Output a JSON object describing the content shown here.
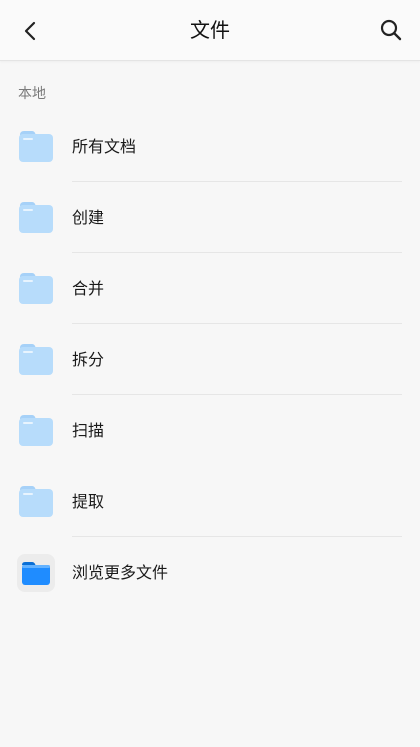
{
  "header": {
    "title": "文件",
    "back_icon": "chevron-left-icon",
    "search_icon": "search-icon"
  },
  "section": {
    "label": "本地"
  },
  "items": [
    {
      "label": "所有文档",
      "icon": "folder-icon"
    },
    {
      "label": "创建",
      "icon": "folder-icon"
    },
    {
      "label": "合并",
      "icon": "folder-icon"
    },
    {
      "label": "拆分",
      "icon": "folder-icon"
    },
    {
      "label": "扫描",
      "icon": "folder-icon"
    },
    {
      "label": "提取",
      "icon": "folder-icon"
    },
    {
      "label": "浏览更多文件",
      "icon": "files-app-icon"
    }
  ],
  "colors": {
    "folder_light": "#b7dcfb",
    "folder_tab": "#a6d1f8",
    "files_app_blue": "#1f8cff",
    "background": "#f7f7f7"
  }
}
